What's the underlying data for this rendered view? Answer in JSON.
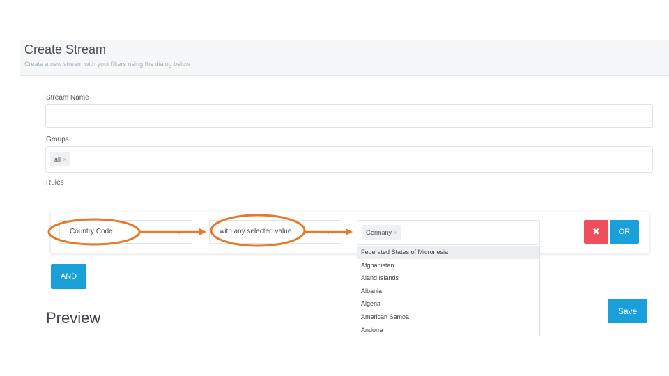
{
  "header": {
    "title": "Create Stream",
    "subtitle": "Create a new stream with your filters using the dialog below"
  },
  "form": {
    "stream_name_label": "Stream Name",
    "stream_name_value": "",
    "groups_label": "Groups",
    "groups_tags": [
      "all"
    ],
    "rules_label": "Rules"
  },
  "rule": {
    "field": "Country Code",
    "operator": "with any selected value",
    "selected_values": [
      "Germany"
    ],
    "tag_remove_glyph": "×",
    "chevron_glyph": "⌄",
    "delete_glyph": "✖",
    "or_label": "OR"
  },
  "dropdown": {
    "items": [
      "Federated States of Micronesia",
      "Afghanistan",
      "Aland Islands",
      "Albania",
      "Algeria",
      "American Samoa",
      "Andorra"
    ],
    "highlighted_index": 0
  },
  "actions": {
    "and_label": "AND",
    "save_label": "Save"
  },
  "preview": {
    "title": "Preview",
    "subtitle": ""
  },
  "colors": {
    "accent": "#1aa0d8",
    "danger": "#ef4f5d",
    "annotation": "#e8792a"
  }
}
